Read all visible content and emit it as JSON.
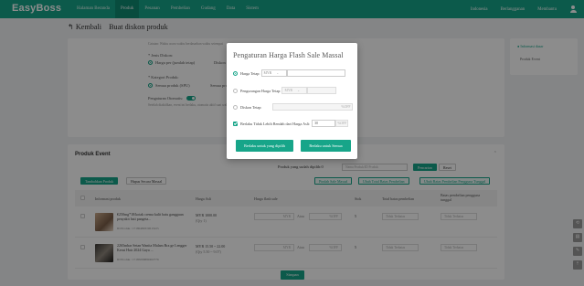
{
  "app": {
    "logo": "EasyBoss",
    "nav": [
      "Halaman Beranda",
      "Produk",
      "Pesanan",
      "Pembelian",
      "Gudang",
      "Data",
      "Sistem"
    ],
    "active_nav": "Produk",
    "top_right": {
      "language": "Indonesia",
      "subscription": "Berlangganan",
      "help": "Membantu"
    }
  },
  "page": {
    "back_label": "Kembali",
    "title": "Buat diskon produk"
  },
  "form": {
    "hint": "Catatan: Waktu acara waktu berdasarkan waktu setempat",
    "discount_type_label": "* Jenis Diskon:",
    "discount_type_option": "Harga per (jumlah tetap)",
    "discount_type_option2": "Diskon",
    "category_label": "* Kategori Produk:",
    "category_option1": "Semua produk (SPU)",
    "category_option2": "Semua produk",
    "preorder_label": "Pengaturan Otomatis:",
    "preorder_note": "Setelah diaktifkan, event ini berlaku, otomatis aktif saat waktu berlangsung"
  },
  "side": {
    "items": [
      "Informasi dasar",
      "Produk Event"
    ]
  },
  "products": {
    "section_title": "Produk Event",
    "selected_text": "Produk yang sudah dipilih:0",
    "search_placeholder": "Nama Produk/ID Produk",
    "search_btn": "Pencarian",
    "reset_btn": "Reset",
    "add_btn": "Tambahkan Produk",
    "bulk_delete_btn": "Hapus Secara Massal",
    "bulk_edit_btn": "Pindah Sale Massal",
    "bulk_limit_btn": "Ubah Total Batas Pembelian",
    "bulk_user_limit_btn": "Ubah Batas Pembelian Pengguna Tunggal",
    "columns": [
      "Informasi produk",
      "Harga Asli",
      "Harga flash sale",
      "Stok",
      "Total batas pembelian",
      "Batas pembelian pengguna tunggal"
    ],
    "rows": [
      {
        "name": "€250mg*18/kotak crema kulit batu gangguan penyakit hati pangeta...",
        "id": "ID Produk : 17180489319615225",
        "price": "MYR 1000.00",
        "price_sub": "(Qty 1)",
        "flash_currency": "MYR",
        "flash_value": "Atau",
        "flash_off": "%OFF",
        "stock": "5",
        "total_limit": "Tidak Terbatas",
        "user_limit": "Tidak Terbatas"
      },
      {
        "name": "2265mbar Setan Wanita Malam Bra ge Lengger Kerut Hair 2024 Gaya ...",
        "id": "ID Produk : 17185066899402776",
        "price": "MYR 15.50 ~ 22.00",
        "price_sub": "(Qty 5.50 ~ 9.07)",
        "flash_currency": "MYR",
        "flash_value": "Atau",
        "flash_off": "%OFF",
        "stock": "5",
        "total_limit": "Tidak Terbatas",
        "user_limit": "Tidak Terbatas"
      }
    ],
    "save_btn": "Simpan"
  },
  "modal": {
    "title": "Pengaturan Harga Flash Sale Massal",
    "opt1_label": "Harga Tetap:",
    "opt1_currency": "MYR",
    "opt2_label": "Pengurangan Harga Tetap:",
    "opt2_currency": "MYR",
    "opt3_label": "Diskon Tetap:",
    "opt3_suffix": "%OFF",
    "check_label": "Berlaku Tidak Lebih Rendah dari Harga Asli:",
    "check_value": "30",
    "check_suffix": "%OFF",
    "btn_selected": "Berlaku untuk yang dipilih",
    "btn_all": "Berlaku untuk Semua"
  }
}
